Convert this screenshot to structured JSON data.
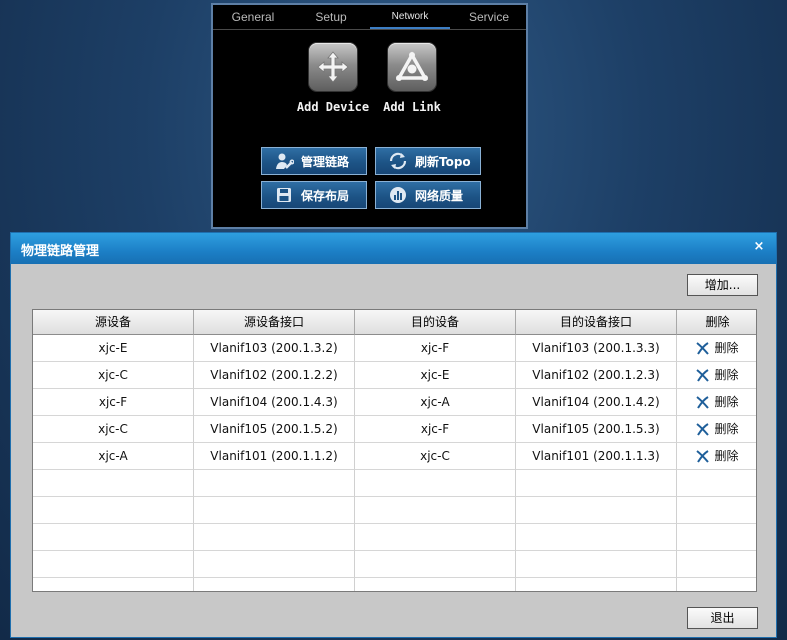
{
  "panel": {
    "tabs": [
      {
        "label": "General"
      },
      {
        "label": "Setup"
      },
      {
        "label": "Network"
      },
      {
        "label": "Service"
      }
    ],
    "add_device": "Add Device",
    "add_link": "Add Link",
    "buttons": {
      "manage_links": "管理链路",
      "refresh_topo": "刷新Topo",
      "save_layout": "保存布局",
      "network_quality": "网络质量"
    }
  },
  "dialog": {
    "title": "物理链路管理",
    "close": "×",
    "add_label": "增加...",
    "exit_label": "退出",
    "columns": [
      "源设备",
      "源设备接口",
      "目的设备",
      "目的设备接口",
      "删除"
    ],
    "rows": [
      {
        "src": "xjc-E",
        "src_if": "Vlanif103 (200.1.3.2)",
        "dst": "xjc-F",
        "dst_if": "Vlanif103 (200.1.3.3)",
        "del": "删除"
      },
      {
        "src": "xjc-C",
        "src_if": "Vlanif102 (200.1.2.2)",
        "dst": "xjc-E",
        "dst_if": "Vlanif102 (200.1.2.3)",
        "del": "删除"
      },
      {
        "src": "xjc-F",
        "src_if": "Vlanif104 (200.1.4.3)",
        "dst": "xjc-A",
        "dst_if": "Vlanif104 (200.1.4.2)",
        "del": "删除"
      },
      {
        "src": "xjc-C",
        "src_if": "Vlanif105 (200.1.5.2)",
        "dst": "xjc-F",
        "dst_if": "Vlanif105 (200.1.5.3)",
        "del": "删除"
      },
      {
        "src": "xjc-A",
        "src_if": "Vlanif101 (200.1.1.2)",
        "dst": "xjc-C",
        "dst_if": "Vlanif101 (200.1.1.3)",
        "del": "删除"
      }
    ]
  },
  "icons": {
    "move": "move-arrows-icon",
    "link": "triangle-link-icon",
    "manage": "user-wrench-icon",
    "refresh": "refresh-arrows-icon",
    "save": "floppy-disk-icon",
    "quality": "chart-circle-icon",
    "delete": "delete-x-icon"
  },
  "colors": {
    "accent": "#1c7fc6",
    "button_blue": "#1d5486",
    "delete_icon": "#1f5f9a"
  }
}
